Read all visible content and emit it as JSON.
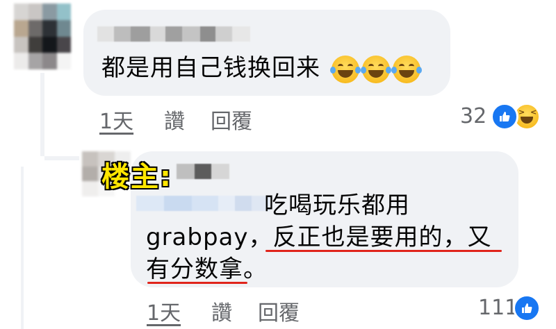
{
  "comment1": {
    "text": "都是用自己钱换回来",
    "emojis": [
      "face-with-tears-of-joy",
      "face-with-tears-of-joy",
      "face-with-tears-of-joy"
    ],
    "time": "1天",
    "like_label": "讚",
    "reply_label": "回覆",
    "reaction_count": "32",
    "reactions": [
      "like",
      "haha"
    ]
  },
  "reply1": {
    "owner_label": "楼主:",
    "text_line1": "吃喝玩乐都用",
    "text_line2": "grabpay，反正也是要用的，又",
    "text_line3": "有分数拿。",
    "time": "1天",
    "like_label": "讚",
    "reply_label": "回覆",
    "reaction_count": "111",
    "reactions": [
      "like"
    ]
  },
  "colors": {
    "bubble": "#f0f2f5",
    "meta_text": "#65676b",
    "like_blue": "#1877f2",
    "owner_label": "#ffe600",
    "underline_red": "#e0241b"
  }
}
